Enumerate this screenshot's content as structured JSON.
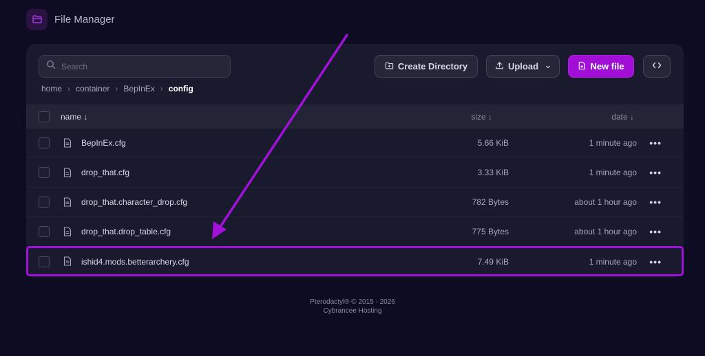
{
  "header": {
    "title": "File Manager",
    "icon": "folder-open-icon"
  },
  "toolbar": {
    "search_placeholder": "Search",
    "create_directory_label": "Create Directory",
    "upload_label": "Upload",
    "new_file_label": "New file",
    "code_toggle_icon": "code-brackets-icon"
  },
  "breadcrumb": [
    "home",
    "container",
    "BepInEx",
    "config"
  ],
  "table": {
    "headers": {
      "name": "name ↓",
      "size": "size ↓",
      "date": "date ↓"
    },
    "rows": [
      {
        "name": "BepInEx.cfg",
        "size": "5.66 KiB",
        "date": "1 minute ago",
        "more": "•••"
      },
      {
        "name": "drop_that.cfg",
        "size": "3.33 KiB",
        "date": "1 minute ago",
        "more": "•••"
      },
      {
        "name": "drop_that.character_drop.cfg",
        "size": "782 Bytes",
        "date": "about 1 hour ago",
        "more": "•••"
      },
      {
        "name": "drop_that.drop_table.cfg",
        "size": "775 Bytes",
        "date": "about 1 hour ago",
        "more": "•••"
      },
      {
        "name": "ishid4.mods.betterarchery.cfg",
        "size": "7.49 KiB",
        "date": "1 minute ago",
        "more": "•••"
      }
    ]
  },
  "footer": {
    "line1": "Pterodactyl® © 2015 - 2026",
    "line2": "Cybrancee Hosting"
  },
  "colors": {
    "accent": "#a10fd6",
    "background": "#0d0c22",
    "card": "#1a1a2e",
    "annotation": "#a012d8"
  }
}
